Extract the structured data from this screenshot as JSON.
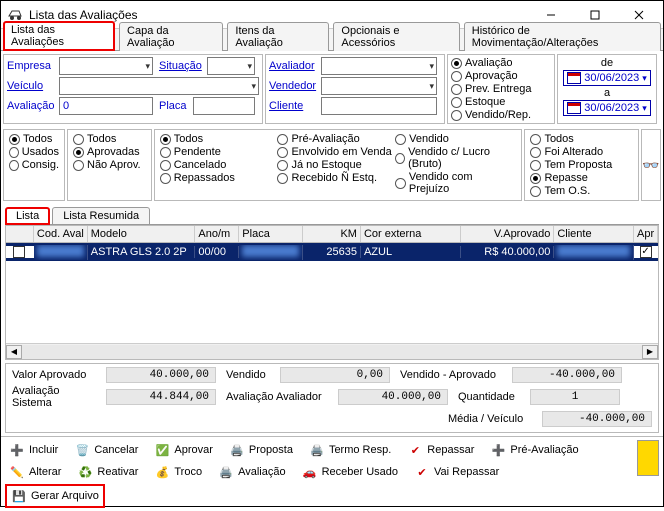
{
  "window": {
    "title": "Lista das Avaliações"
  },
  "tabs": {
    "t0": "Lista das Avaliações",
    "t1": "Capa da Avaliação",
    "t2": "Itens da Avaliação",
    "t3": "Opcionais e Acessórios",
    "t4": "Histórico de Movimentação/Alterações"
  },
  "filters": {
    "empresa": "Empresa",
    "veiculo": "Veículo",
    "avaliacao": "Avaliação",
    "avaliacao_val": "0",
    "situacao": "Situação",
    "placa": "Placa",
    "avaliador": "Avaliador",
    "vendedor": "Vendedor",
    "cliente": "Cliente"
  },
  "type_radios": {
    "r0": "Avaliação",
    "r1": "Aprovação",
    "r2": "Prev. Entrega",
    "r3": "Estoque",
    "r4": "Vendido/Rep."
  },
  "dates": {
    "de": "de",
    "a": "a",
    "from": "30/06/2023",
    "to": "30/06/2023"
  },
  "status_a": {
    "r0": "Todos",
    "r1": "Usados",
    "r2": "Consig."
  },
  "status_b": {
    "r0": "Todos",
    "r1": "Aprovadas",
    "r2": "Não Aprov."
  },
  "status_c": {
    "c0": "Todos",
    "c1": "Pendente",
    "c2": "Cancelado",
    "c3": "Repassados",
    "c4": "Pré-Avaliação",
    "c5": "Envolvido em Venda",
    "c6": "Já no Estoque",
    "c7": "Recebido Ñ Estq.",
    "c8": "Vendido",
    "c9": "Vendido c/ Lucro (Bruto)",
    "c10": "Vendido com Prejuízo"
  },
  "status_d": {
    "r0": "Todos",
    "r1": "Foi Alterado",
    "r2": "Tem Proposta",
    "r3": "Repasse",
    "r4": "Tem O.S."
  },
  "subtabs": {
    "s0": "Lista",
    "s1": "Lista Resumida"
  },
  "grid": {
    "h0": "",
    "h1": "Cod. Aval",
    "h2": "Modelo",
    "h3": "Ano/m",
    "h4": "Placa",
    "h5": "KM",
    "h6": "Cor externa",
    "h7": "V.Aprovado",
    "h8": "Cliente",
    "h9": "Apr",
    "row0": {
      "modelo": "ASTRA GLS 2.0 2P",
      "ano": "00/00",
      "km": "25635",
      "cor": "AZUL",
      "vaprov": "R$ 40.000,00"
    }
  },
  "totals": {
    "l_valor_aprov": "Valor Aprovado",
    "v_valor_aprov": "40.000,00",
    "l_vendido": "Vendido",
    "v_vendido": "0,00",
    "l_vend_aprov": "Vendido - Aprovado",
    "v_vend_aprov": "-40.000,00",
    "l_aval_sist": "Avaliação Sistema",
    "v_aval_sist": "44.844,00",
    "l_aval_avaliador": "Avaliação Avaliador",
    "v_aval_avaliador": "40.000,00",
    "l_qtde": "Quantidade",
    "v_qtde": "1",
    "l_media": "Média / Veículo",
    "v_media": "-40.000,00"
  },
  "toolbar": {
    "incluir": "Incluir",
    "cancelar": "Cancelar",
    "aprovar": "Aprovar",
    "proposta": "Proposta",
    "termo": "Termo Resp.",
    "repassar": "Repassar",
    "preaval": "Pré-Avaliação",
    "alterar": "Alterar",
    "reativar": "Reativar",
    "troco": "Troco",
    "avaliacao": "Avaliação",
    "receber": "Receber Usado",
    "vairepassar": "Vai Repassar",
    "gerar": "Gerar Arquivo"
  }
}
